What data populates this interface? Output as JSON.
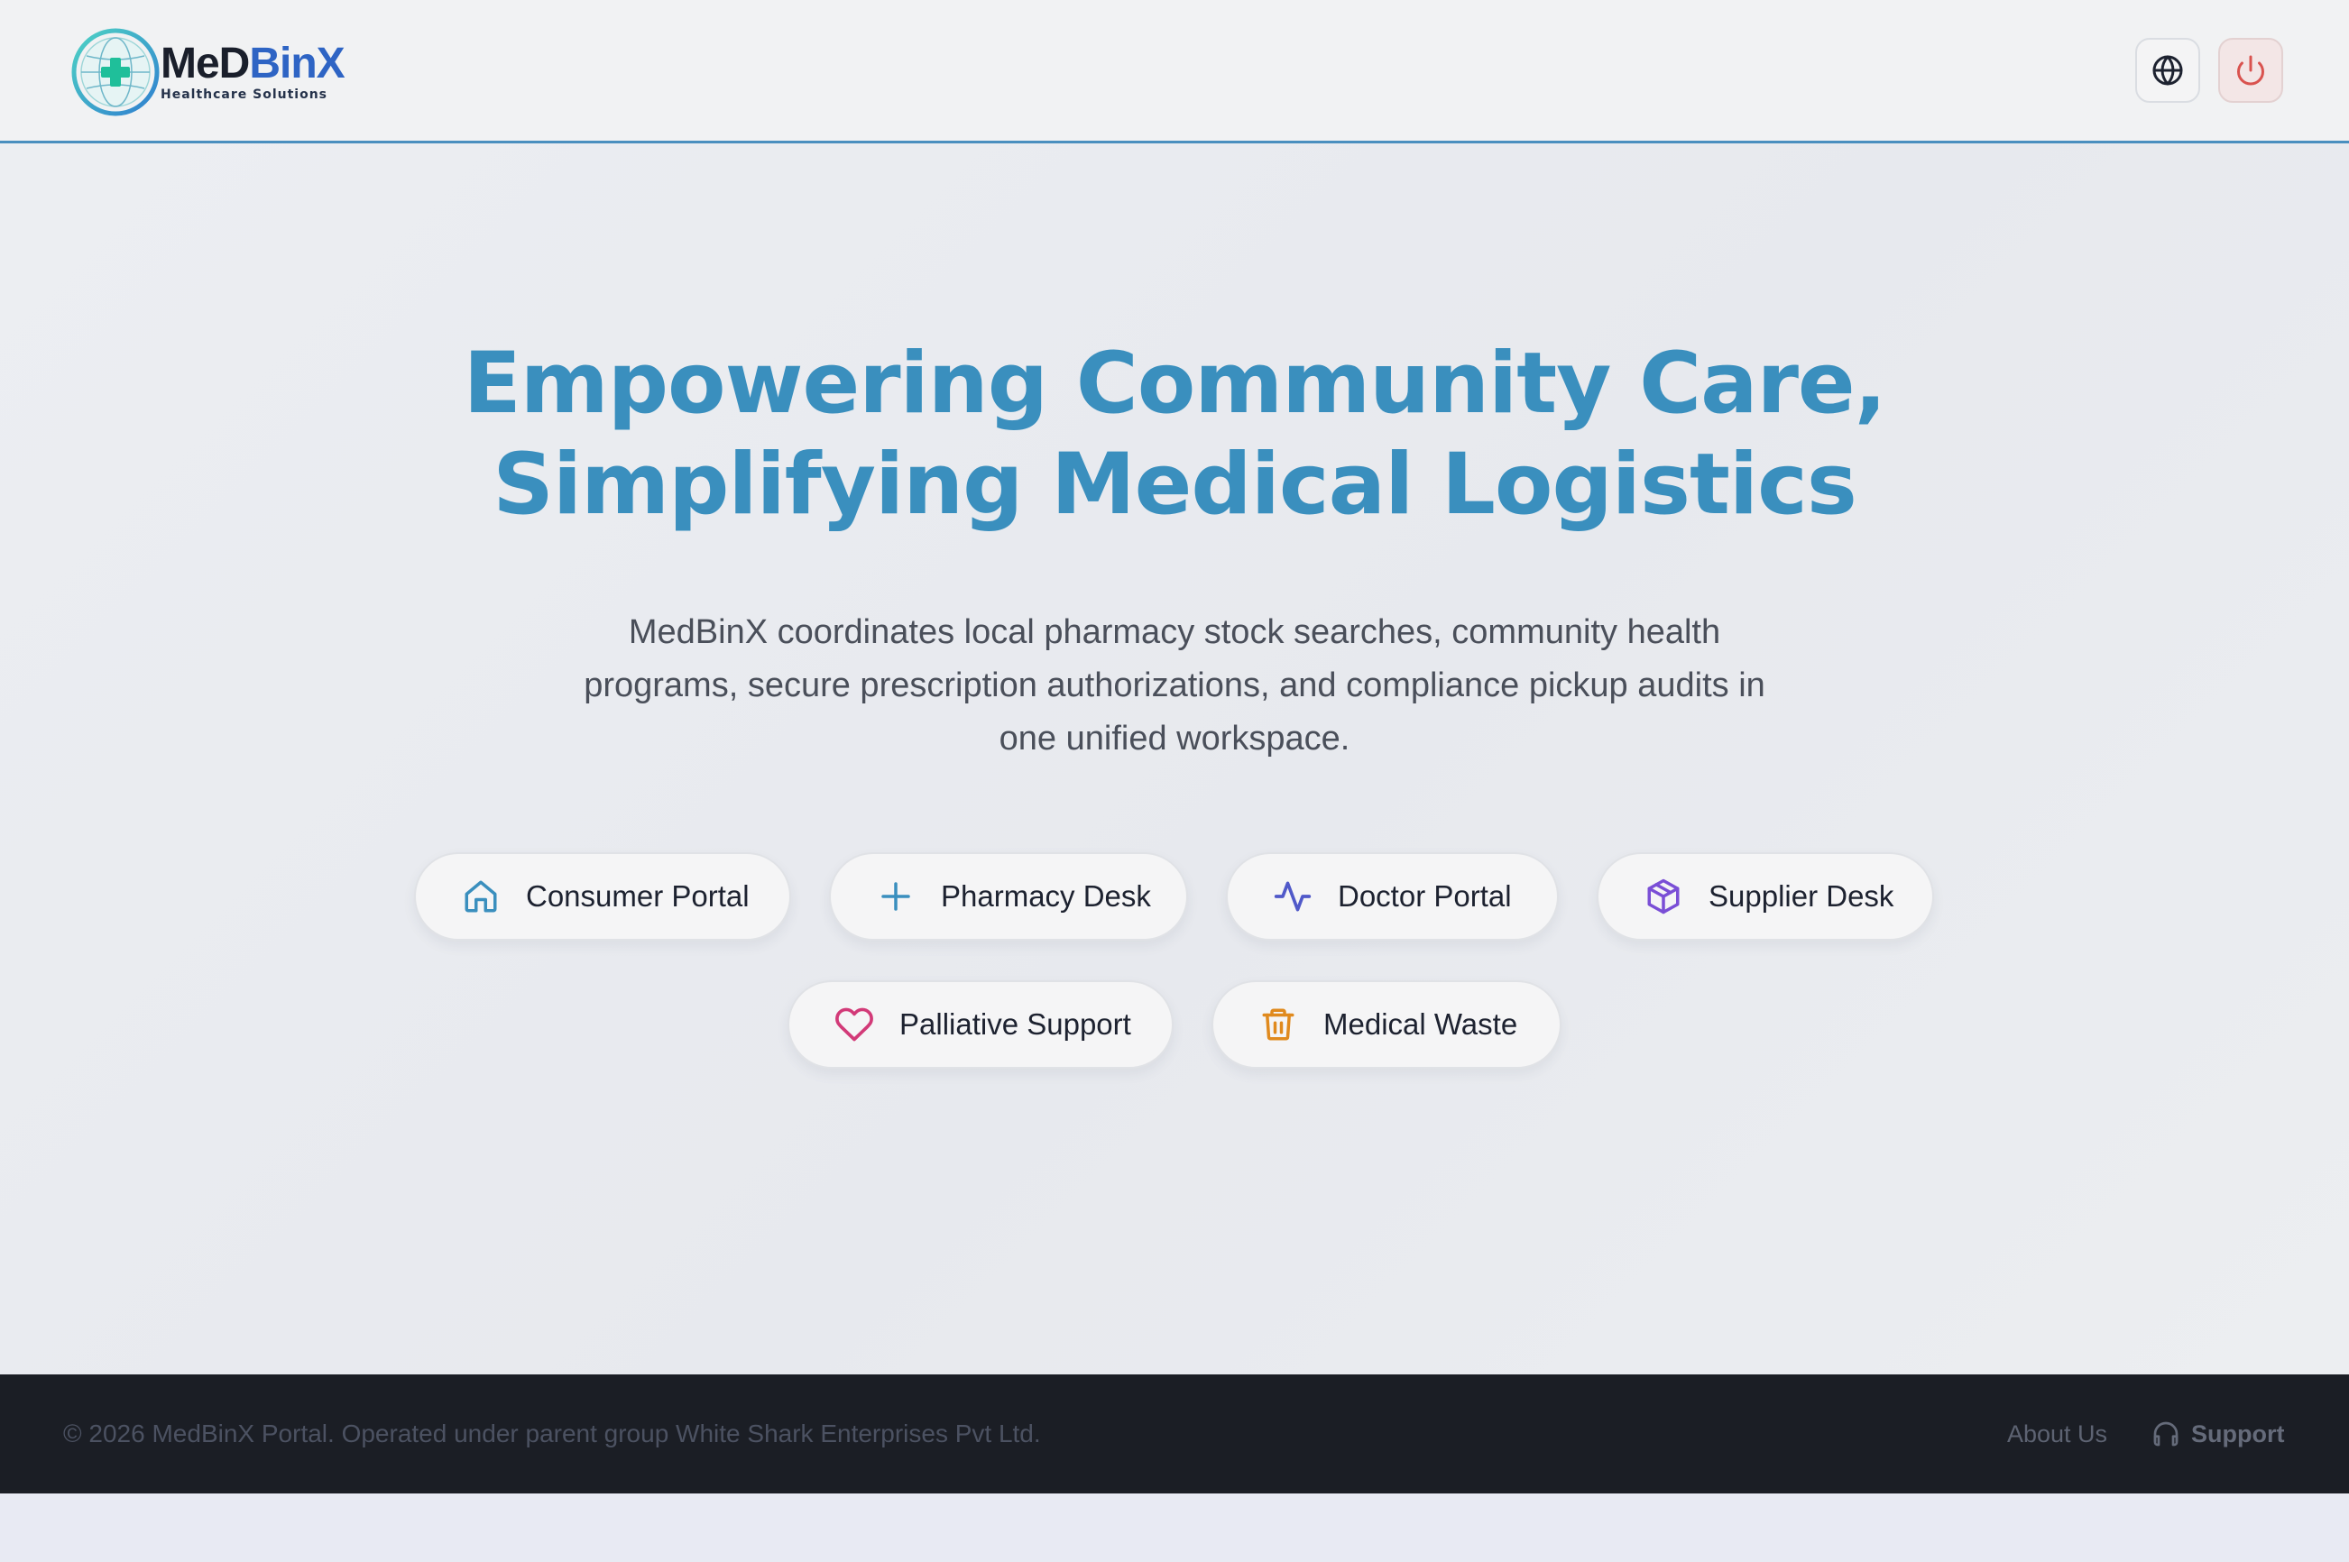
{
  "brand": {
    "name_part1": "MeD",
    "name_part2": "BinX",
    "tagline": "Healthcare Solutions"
  },
  "header": {
    "language_icon": "globe-icon",
    "power_icon": "power-icon"
  },
  "hero": {
    "title_line1": "Empowering Community Care,",
    "title_line2": "Simplifying Medical Logistics",
    "description": "MedBinX coordinates local pharmacy stock searches, community health programs, secure prescription authorizations, and compliance pickup audits in one unified workspace."
  },
  "portals": [
    {
      "label": "Consumer Portal",
      "icon": "home-icon",
      "color": "#3a8fbe"
    },
    {
      "label": "Pharmacy Desk",
      "icon": "plus-icon",
      "color": "#3a8fbe"
    },
    {
      "label": "Doctor Portal",
      "icon": "activity-icon",
      "color": "#5059c9"
    },
    {
      "label": "Supplier Desk",
      "icon": "package-icon",
      "color": "#7a4fd6"
    },
    {
      "label": "Palliative Support",
      "icon": "heart-icon",
      "color": "#d23a78"
    },
    {
      "label": "Medical Waste",
      "icon": "trash-icon",
      "color": "#e08a1e"
    }
  ],
  "footer": {
    "copyright": "© 2026 MedBinX Portal. Operated under parent group White Shark Enterprises Pvt Ltd.",
    "about_label": "About Us",
    "support_label": "Support",
    "support_icon": "headset-icon"
  },
  "colors": {
    "accent": "#3a8fbe",
    "brand_blue": "#2e64c4",
    "footer_bg": "#1b1e25",
    "power_red": "#d9534f"
  }
}
